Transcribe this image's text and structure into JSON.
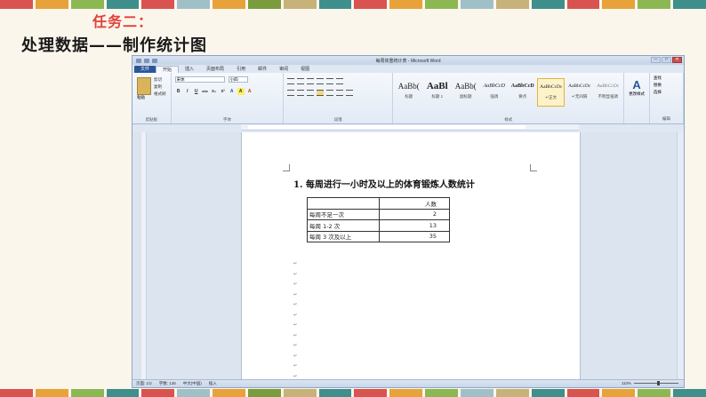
{
  "slide": {
    "title_line1": "任务二：",
    "title_line2": "处理数据——制作统计图",
    "stripe_colors": [
      "#d9534f",
      "#e8a23a",
      "#8cb854",
      "#3f8f8c",
      "#d9534f",
      "#a0c0c8",
      "#e8a23a",
      "#7a9c3c",
      "#c7b27a",
      "#3f8f8c",
      "#d9534f",
      "#e8a23a",
      "#8cb854",
      "#a0c0c8",
      "#c7b27a",
      "#3f8f8c",
      "#d9534f",
      "#e8a23a",
      "#8cb854",
      "#3f8f8c"
    ]
  },
  "word": {
    "window_title": "每周体重统计表 - Microsoft Word",
    "quick_access_icons": [
      "save-icon",
      "undo-icon",
      "redo-icon",
      "customize-icon"
    ],
    "window_controls": [
      "─",
      "□",
      "✕"
    ],
    "tabs": [
      "文件",
      "开始",
      "插入",
      "页面布局",
      "引用",
      "邮件",
      "审阅",
      "视图"
    ],
    "active_tab": "开始",
    "ribbon": {
      "clipboard": {
        "paste_label": "粘贴",
        "cut": "剪切",
        "copy": "复制",
        "format_painter": "格式刷",
        "group_label": "剪贴板"
      },
      "font": {
        "font_name": "宋体",
        "font_size": "小四",
        "group_label": "字体",
        "format_buttons": [
          "B",
          "I",
          "U",
          "abe",
          "x₂",
          "x²",
          "A",
          "A",
          "A"
        ]
      },
      "paragraph": {
        "group_label": "段落"
      },
      "styles": {
        "group_label": "样式",
        "items": [
          {
            "preview": "AaBb(",
            "name": "标题"
          },
          {
            "preview": "AaBl",
            "name": "标题 1"
          },
          {
            "preview": "AaBb(",
            "name": "副标题"
          },
          {
            "preview": "AaBbCcD",
            "name": "强调"
          },
          {
            "preview": "AaBbCcD",
            "name": "要点"
          },
          {
            "preview": "AaBbCcDc",
            "name": "↵正文"
          },
          {
            "preview": "AaBbCcDc",
            "name": "↵无间隔"
          },
          {
            "preview": "AaBbCcDc",
            "name": "不明显强调"
          }
        ],
        "selected_index": 5
      },
      "change_styles": {
        "label": "更改样式"
      },
      "editing": {
        "find": "查找",
        "replace": "替换",
        "select": "选择",
        "group_label": "编辑"
      }
    },
    "document": {
      "heading": "1. 每周进行一小时及以上的体育锻炼人数统计",
      "table": {
        "header": [
          "",
          "人数"
        ],
        "rows": [
          [
            "每周不足一次",
            "2"
          ],
          [
            "每周 1-2 次",
            "13"
          ],
          [
            "每周 3 次及以上",
            "35"
          ]
        ]
      },
      "paragraph_mark": "↵"
    },
    "status_bar": {
      "page": "页面: 1/2",
      "words": "字数: 136",
      "language": "中文(中国)",
      "mode": "插入",
      "zoom": "110%"
    }
  }
}
